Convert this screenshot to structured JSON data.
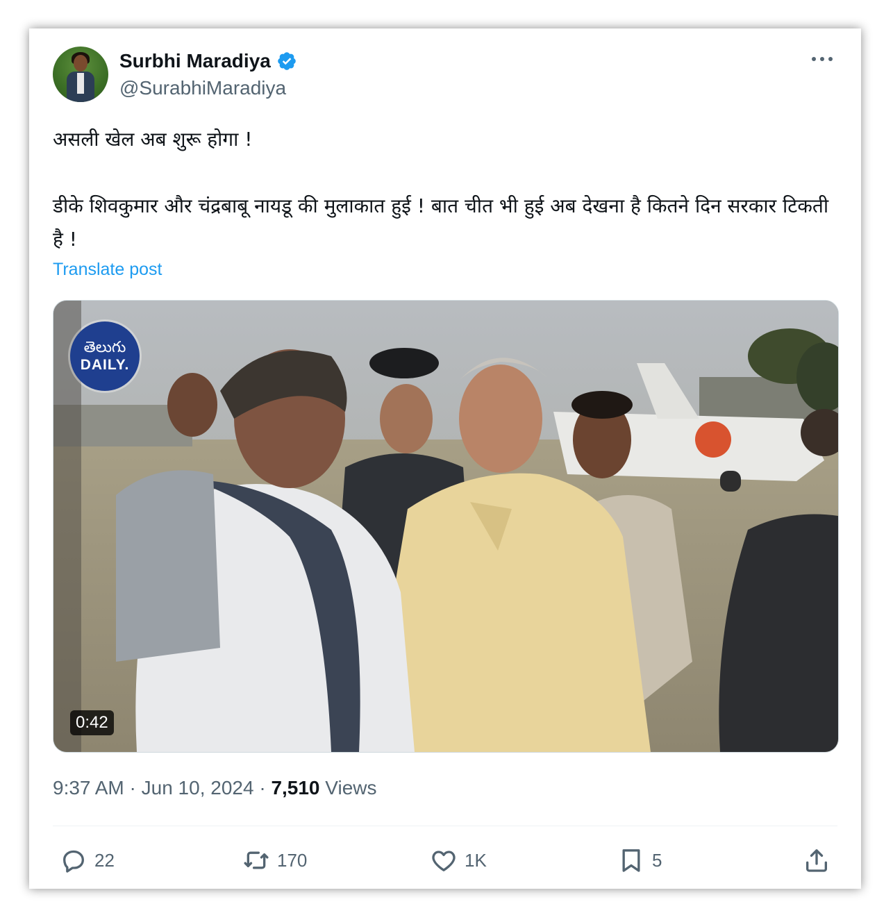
{
  "author": {
    "name": "Surbhi Maradiya",
    "handle": "@SurabhiMaradiya",
    "verified": true
  },
  "post": {
    "text_line1": "असली खेल अब शुरू होगा !",
    "text_line2": "डीके शिवकुमार और चंद्रबाबू नायडू की मुलाकात हुई ! बात चीत भी हुई अब देखना है कितने दिन सरकार टिकती है !",
    "translate_label": "Translate post"
  },
  "media": {
    "logo_line1": "తెలుగు",
    "logo_line2": "DAILY.",
    "duration": "0:42"
  },
  "meta": {
    "time": "9:37 AM",
    "separator": "·",
    "date": "Jun 10, 2024",
    "views_count": "7,510",
    "views_label": "Views"
  },
  "actions": {
    "reply_count": "22",
    "repost_count": "170",
    "like_count": "1K",
    "bookmark_count": "5"
  },
  "colors": {
    "link": "#1d9bf0",
    "secondary_text": "#536471",
    "verified_badge": "#1d9bf0"
  },
  "icons": [
    "verified-badge-icon",
    "more-icon",
    "reply-icon",
    "repost-icon",
    "like-icon",
    "bookmark-icon",
    "share-icon"
  ]
}
